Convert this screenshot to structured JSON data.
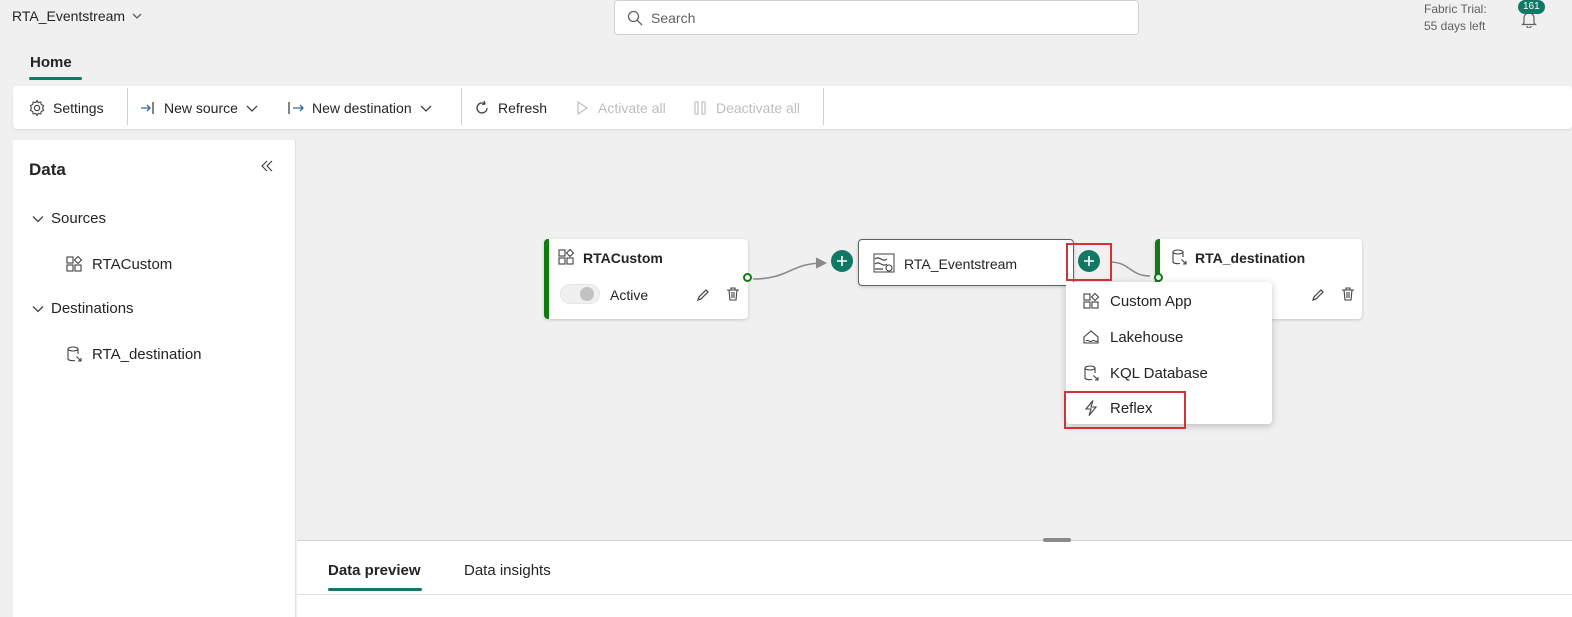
{
  "topbar": {
    "app_title": "RTA_Eventstream",
    "search_placeholder": "Search",
    "trial_line1": "Fabric Trial:",
    "trial_line2": "55 days left",
    "notification_count": "161"
  },
  "tabs": {
    "home": "Home"
  },
  "ribbon": {
    "settings": "Settings",
    "new_source": "New source",
    "new_destination": "New destination",
    "refresh": "Refresh",
    "activate_all": "Activate all",
    "deactivate_all": "Deactivate all"
  },
  "sidebar": {
    "title": "Data",
    "sources_label": "Sources",
    "sources": [
      {
        "label": "RTACustom",
        "icon": "custom-app-icon"
      }
    ],
    "destinations_label": "Destinations",
    "destinations": [
      {
        "label": "RTA_destination",
        "icon": "kql-database-icon"
      }
    ]
  },
  "canvas": {
    "source_node": {
      "title": "RTACustom",
      "status": "Active"
    },
    "stream_node": {
      "title": "RTA_Eventstream"
    },
    "destination_node": {
      "title": "RTA_destination"
    }
  },
  "dropdown_menu": {
    "items": [
      {
        "label": "Custom App",
        "icon": "custom-app-icon"
      },
      {
        "label": "Lakehouse",
        "icon": "lakehouse-icon"
      },
      {
        "label": "KQL Database",
        "icon": "kql-database-icon"
      },
      {
        "label": "Reflex",
        "icon": "reflex-icon"
      }
    ]
  },
  "bottom_tabs": {
    "preview": "Data preview",
    "insights": "Data insights"
  },
  "colors": {
    "accent": "#117865",
    "active_bar": "#107c10",
    "highlight": "#d13438"
  }
}
